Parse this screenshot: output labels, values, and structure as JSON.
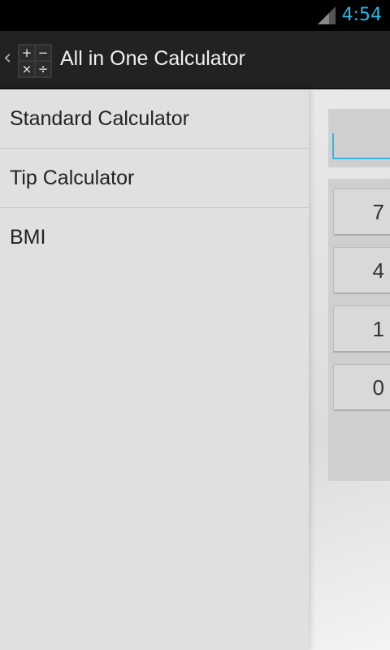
{
  "status_bar": {
    "time": "4:54",
    "signal_icon": "signal-icon"
  },
  "action_bar": {
    "title": "All in One Calculator",
    "icon": {
      "plus": "+",
      "minus": "−",
      "times": "×",
      "divide": "÷"
    }
  },
  "drawer": {
    "items": [
      {
        "label": "Standard Calculator"
      },
      {
        "label": "Tip Calculator"
      },
      {
        "label": "BMI"
      }
    ]
  },
  "calculator": {
    "keys": [
      "7",
      "4",
      "1",
      "0"
    ]
  },
  "colors": {
    "accent": "#33b5e5",
    "action_bar": "#222222",
    "drawer": "#e0e0e0"
  }
}
